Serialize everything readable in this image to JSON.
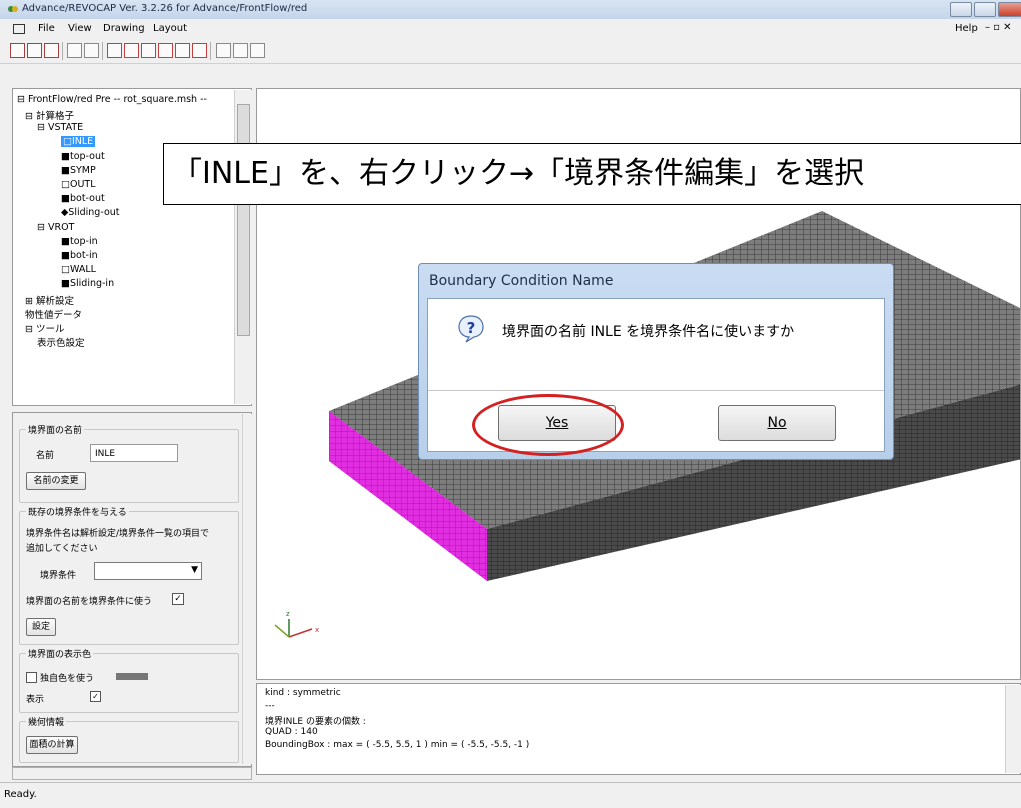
{
  "window": {
    "title": "Advance/REVOCAP Ver. 3.2.26 for Advance/FrontFlow/red"
  },
  "menu": {
    "items": [
      "File",
      "View",
      "Drawing",
      "Layout"
    ],
    "help": "Help"
  },
  "tree": {
    "root": "FrontFlow/red Pre -- rot_square.msh --",
    "items": [
      {
        "label": "計算格子",
        "level": 1,
        "marker": "⊟"
      },
      {
        "label": "VSTATE",
        "level": 2,
        "marker": "⊟"
      },
      {
        "label": "□INLE",
        "level": 3,
        "selected": true
      },
      {
        "label": "■top-out",
        "level": 3
      },
      {
        "label": "■SYMP",
        "level": 3
      },
      {
        "label": "□OUTL",
        "level": 3
      },
      {
        "label": "■bot-out",
        "level": 3
      },
      {
        "label": "◆Sliding-out",
        "level": 3
      },
      {
        "label": "VROT",
        "level": 2,
        "marker": "⊟"
      },
      {
        "label": "■top-in",
        "level": 3
      },
      {
        "label": "■bot-in",
        "level": 3
      },
      {
        "label": "□WALL",
        "level": 3
      },
      {
        "label": "■Sliding-in",
        "level": 3
      },
      {
        "label": "解析設定",
        "level": 1,
        "marker": "⊞"
      },
      {
        "label": "物性値データ",
        "level": 1,
        "marker": ""
      },
      {
        "label": "ツール",
        "level": 1,
        "marker": "⊟"
      },
      {
        "label": "表示色設定",
        "level": 2,
        "marker": ""
      }
    ]
  },
  "props": {
    "boundary_name_group": "境界面の名前",
    "name_label": "名前",
    "name_value": "INLE",
    "rename_button": "名前の変更",
    "existing_group": "既存の境界条件を与える",
    "existing_note1": "境界条件名は解析設定/境界条件一覧の項目で",
    "existing_note2": "追加してください",
    "bc_label": "境界条件",
    "use_name_label": "境界面の名前を境界条件に使う",
    "set_button": "設定",
    "color_group": "境界面の表示色",
    "own_color_label": "独自色を使う",
    "show_label": "表示",
    "geom_group": "幾何情報",
    "area_button": "面積の計算"
  },
  "annotation": {
    "text": "「INLE」を、右クリック→「境界条件編集」を選択"
  },
  "dialog": {
    "title": "Boundary Condition Name",
    "message": "境界面の名前 INLE を境界条件名に使いますか",
    "yes": "Yes",
    "no": "No"
  },
  "console": {
    "lines": [
      "kind : symmetric",
      "---",
      "境界INLE の要素の個数 :",
      "QUAD : 140",
      "BoundingBox : max = ( -5.5, 5.5, 1 ) min = ( -5.5, -5.5, -1 )"
    ]
  },
  "status": {
    "text": "Ready."
  },
  "colors": {
    "selected_bg": "#3399ff",
    "highlight_face": "#e02ee0",
    "mesh_gray": "#555555",
    "accent_red": "#d42020"
  }
}
